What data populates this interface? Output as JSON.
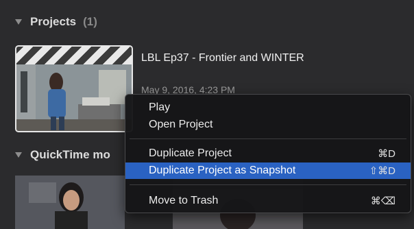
{
  "projects": {
    "title": "Projects",
    "count": "(1)",
    "item": {
      "title": "LBL Ep37 - Frontier and WINTER",
      "date": "May 9, 2016, 4:23 PM"
    }
  },
  "quicktime": {
    "title": "QuickTime mo"
  },
  "menu": {
    "items": [
      {
        "label": "Play",
        "shortcut": ""
      },
      {
        "label": "Open Project",
        "shortcut": ""
      },
      {
        "label": "Duplicate Project",
        "shortcut": "⌘D"
      },
      {
        "label": "Duplicate Project as Snapshot",
        "shortcut": "⇧⌘D",
        "highlighted": true
      },
      {
        "label": "Move to Trash",
        "shortcut": "⌘⌫"
      }
    ]
  },
  "colors": {
    "highlight": "#2a62c2",
    "background": "#2b2b2d"
  },
  "icons": {
    "disclosure": "disclosure-triangle-icon"
  }
}
